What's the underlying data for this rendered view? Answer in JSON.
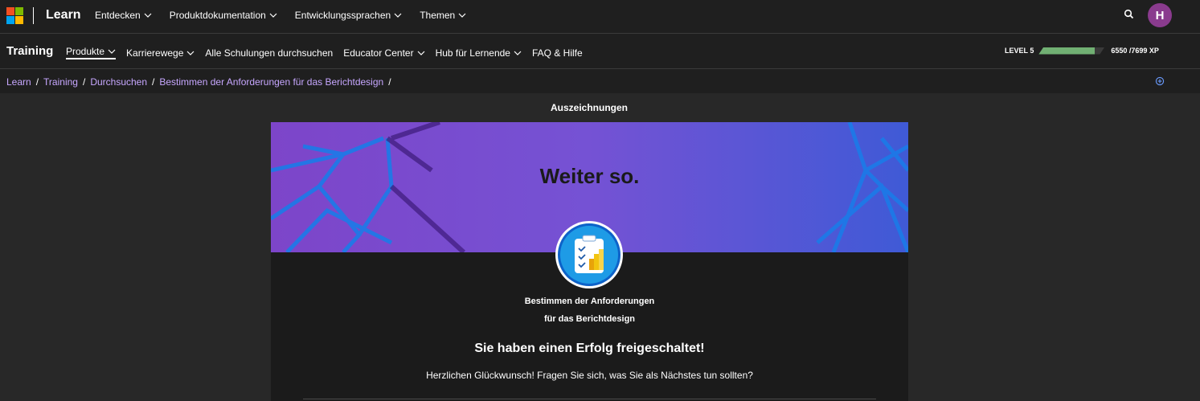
{
  "topnav": {
    "brand": "Learn",
    "menu": [
      {
        "label": "Entdecken"
      },
      {
        "label": "Produktdokumentation"
      },
      {
        "label": "Entwicklungssprachen"
      },
      {
        "label": "Themen"
      }
    ],
    "avatar_initial": "H",
    "logo_colors": [
      "#f25022",
      "#7fba00",
      "#00a4ef",
      "#ffb900"
    ]
  },
  "subnav": {
    "title": "Training",
    "menu": [
      {
        "label": "Produkte"
      },
      {
        "label": "Karrierewege"
      },
      {
        "label": "Alle Schulungen durchsuchen"
      },
      {
        "label": "Educator Center"
      },
      {
        "label": "Hub für Lernende"
      },
      {
        "label": "FAQ & Hilfe"
      }
    ],
    "level_label": "LEVEL 5",
    "xp_text": "6550 /7699 XP",
    "xp_progress": 0.85,
    "progress_color": "#71b073"
  },
  "breadcrumb": [
    "Learn",
    "Training",
    "Durchsuchen",
    "Bestimmen der Anforderungen für das Berichtdesign"
  ],
  "main": {
    "heading": "Auszeichnungen",
    "banner_title": "Weiter so.",
    "caption_line1": "Bestimmen der Anforderungen",
    "caption_line2": "für das Berichtdesign",
    "unlock_text": "Sie haben einen Erfolg freigeschaltet!",
    "desc": "Herzlichen Glückwunsch! Fragen Sie sich, was Sie als Nächstes tun sollten?",
    "accent_purple": "#7b52d6",
    "badge_icon": "clipboard-chart-icon"
  }
}
